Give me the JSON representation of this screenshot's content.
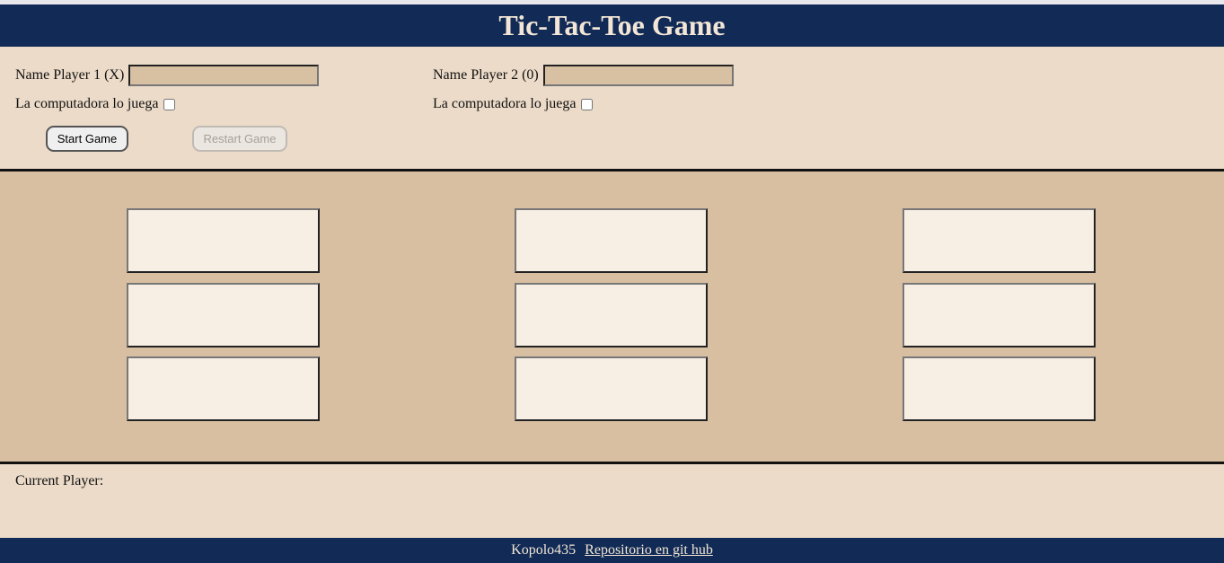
{
  "header": {
    "title": "Tic-Tac-Toe Game"
  },
  "players": [
    {
      "name_label": "Name Player 1 (X)",
      "name_value": "",
      "cpu_label": "La computadora lo juega",
      "cpu_checked": false
    },
    {
      "name_label": "Name Player 2 (0)",
      "name_value": "",
      "cpu_label": "La computadora lo juega",
      "cpu_checked": false
    }
  ],
  "controls": {
    "start_label": "Start Game",
    "restart_label": "Restart Game",
    "restart_disabled": true
  },
  "board": {
    "cells": [
      "",
      "",
      "",
      "",
      "",
      "",
      "",
      "",
      ""
    ]
  },
  "status": {
    "current_player_label": "Current Player:",
    "current_player_value": ""
  },
  "footer": {
    "author": "Kopolo435",
    "repo_link": "Repositorio en git hub"
  },
  "colors": {
    "navy": "#112b56",
    "beige": "#ecdbc8",
    "board_tan": "#d8bfa2",
    "cell_fill": "#f7eee4"
  }
}
